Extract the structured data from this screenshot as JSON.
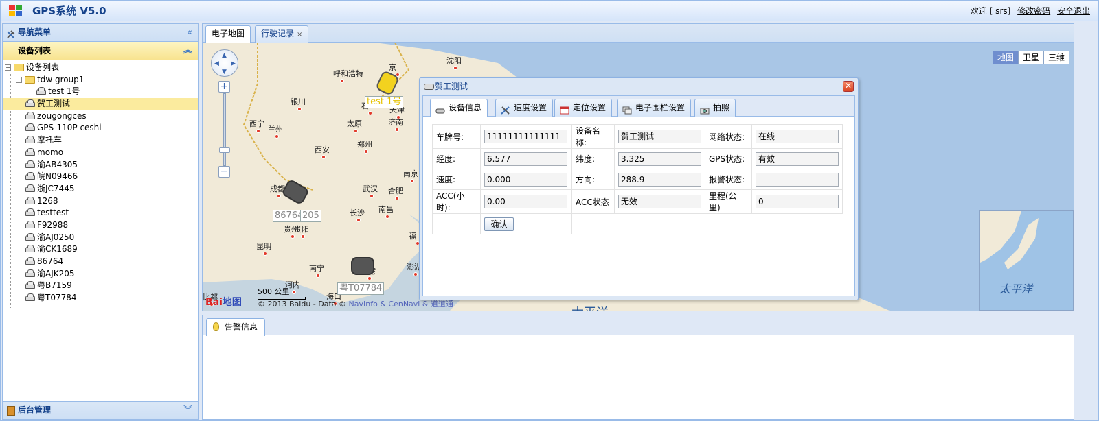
{
  "app": {
    "title": "GPS系统 V5.0"
  },
  "top_right": {
    "welcome": "欢迎 [ srs]",
    "change_password": "修改密码",
    "logout": "安全退出"
  },
  "left": {
    "nav_title": "导航菜单",
    "collapse_icon": "«",
    "devlist_title": "设备列表",
    "devlist_toggle": "︽",
    "tree": {
      "root": "设备列表",
      "group": "tdw group1",
      "group_child": "test 1号",
      "items": [
        "贺工测试",
        "zougongces",
        "GPS-110P ceshi",
        "摩托车",
        "momo",
        "渝AB4305",
        "皖N09466",
        "浙JC7445",
        "1268",
        "testtest",
        "F92988",
        "渝AJ0250",
        "渝CK1689",
        "86764",
        "渝AJK205",
        "粤B7159",
        "粤T07784"
      ],
      "selected_index": 0
    },
    "bottom_title": "后台管理",
    "bottom_toggle": "︾"
  },
  "tabs": [
    {
      "label": "电子地图",
      "active": true
    },
    {
      "label": "行驶记录",
      "close": "×"
    }
  ],
  "map": {
    "types": [
      "地图",
      "卫星",
      "三维"
    ],
    "active_type": "地图",
    "cities": [
      "沈阳",
      "呼和浩特",
      "京",
      "银川",
      "西宁",
      "兰州",
      "太原",
      "济南",
      "天津",
      "石",
      "西安",
      "郑州",
      "成都",
      "武汉",
      "南京",
      "合肥",
      "贵州",
      "长沙",
      "南昌",
      "福",
      "昆明",
      "南宁",
      "澎湖",
      "贵阳",
      "河内",
      "海口",
      "比都",
      "香港"
    ],
    "vehicle_labels": [
      "test 1号",
      "86764",
      "205",
      "粤T07784"
    ],
    "scale": "500 公里",
    "copyright_prefix": "© 2013 Baidu - Data ©",
    "copyright_links": [
      "NavInfo",
      "& CenNavi",
      "& 道道通"
    ],
    "baidu_logo": "Bai",
    "baidu_logo_2": "地图",
    "ocean": "太平洋",
    "ocean2": "太平洋"
  },
  "popup": {
    "title": "贺工测试",
    "close": "✕",
    "tabs": [
      "设备信息",
      "速度设置",
      "定位设置",
      "电子围栏设置",
      "拍照"
    ],
    "active_tab": 0,
    "rows": [
      [
        {
          "k": "车牌号:",
          "v": "11111111111111"
        },
        {
          "k": "设备名称:",
          "v": "贺工测试"
        },
        {
          "k": "网络状态:",
          "v": "在线"
        }
      ],
      [
        {
          "k": "经度:",
          "v": "6.577"
        },
        {
          "k": "纬度:",
          "v": "3.325"
        },
        {
          "k": "GPS状态:",
          "v": "有效"
        }
      ],
      [
        {
          "k": "速度:",
          "v": "0.000"
        },
        {
          "k": "方向:",
          "v": "288.9"
        },
        {
          "k": "报警状态:",
          "v": ""
        }
      ],
      [
        {
          "k": "ACC(小时):",
          "v": "0.00"
        },
        {
          "k": "ACC状态",
          "v": "无效"
        },
        {
          "k": "里程(公里)",
          "v": "0"
        }
      ]
    ],
    "confirm": "确认"
  },
  "alert": {
    "tab": "告警信息"
  }
}
